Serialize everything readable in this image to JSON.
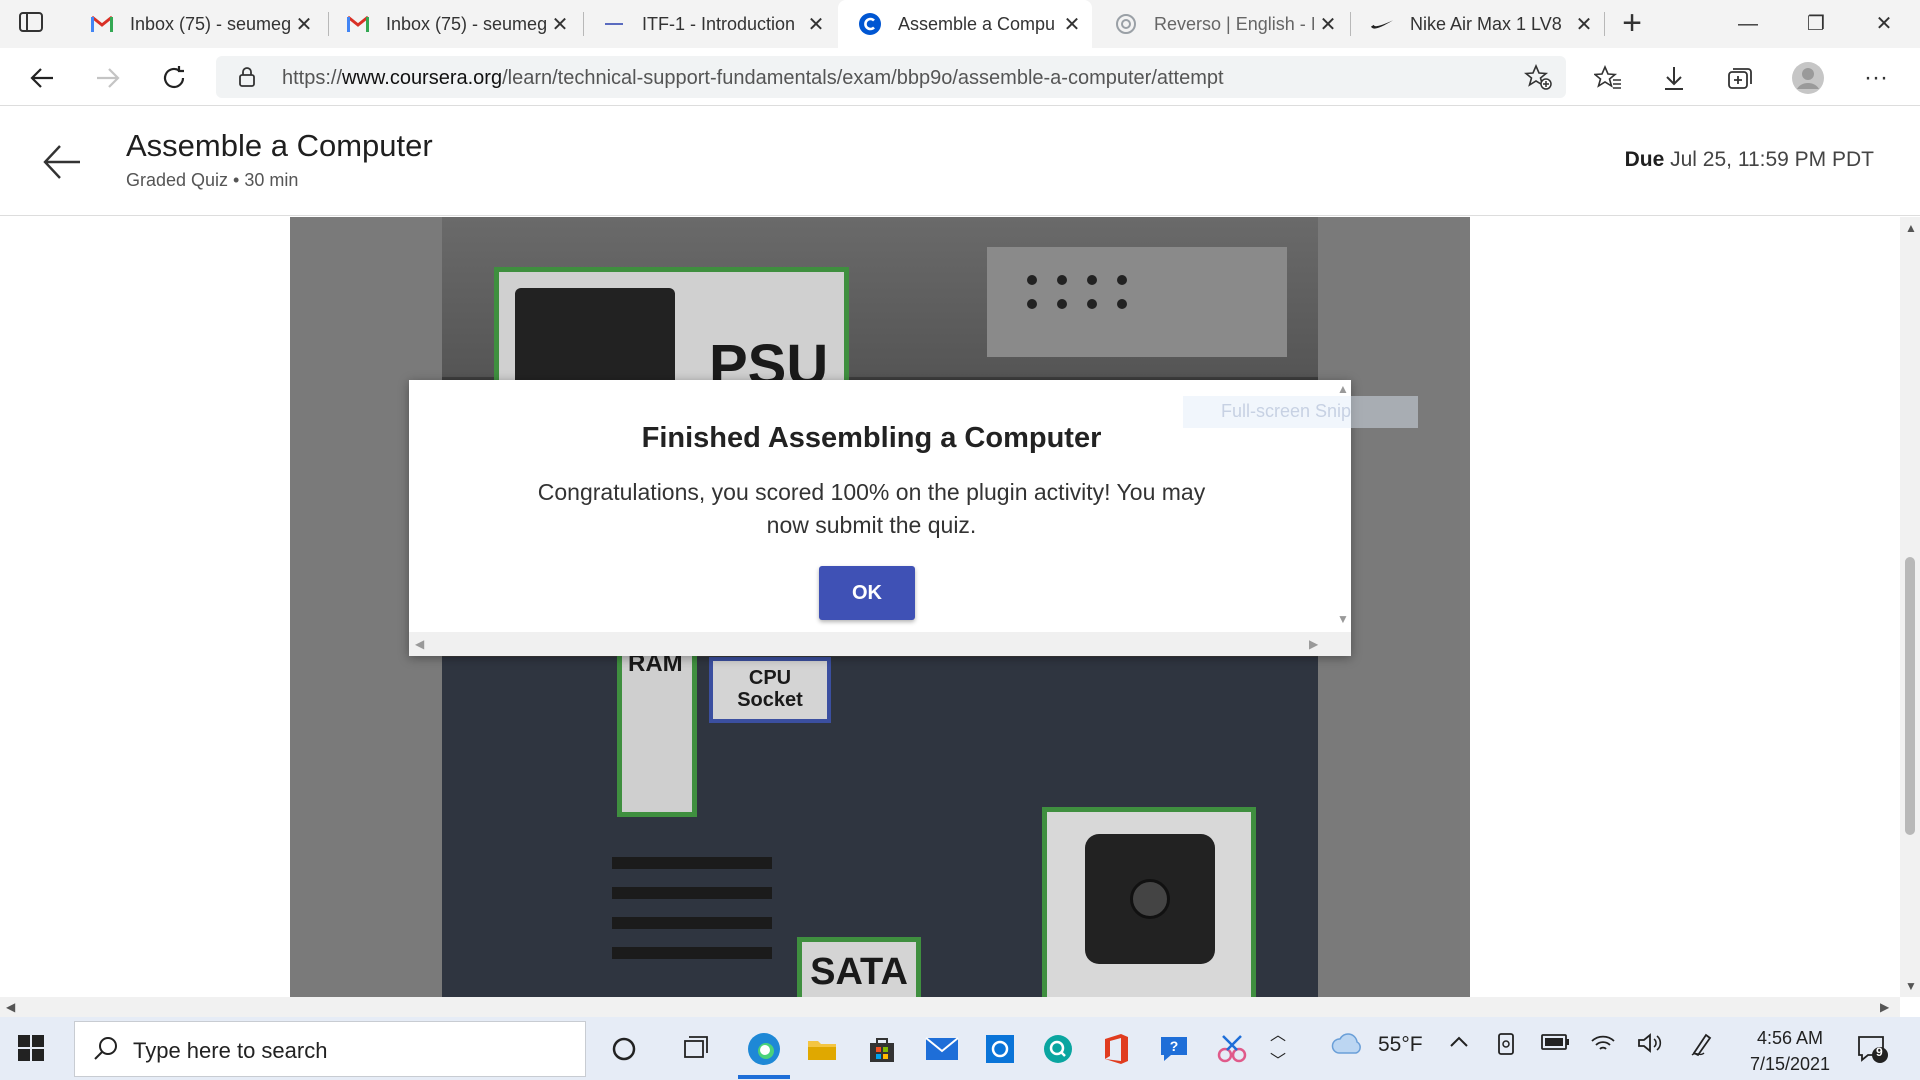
{
  "browser": {
    "tabs": [
      {
        "title": "Inbox (75) - seumeg",
        "icon": "gmail-icon",
        "active": false
      },
      {
        "title": "Inbox (75) - seumeg",
        "icon": "gmail-icon",
        "active": false
      },
      {
        "title": "ITF-1 - Introduction",
        "icon": "generic-tab-icon",
        "active": false
      },
      {
        "title": "Assemble a Compu",
        "icon": "coursera-icon",
        "active": true
      },
      {
        "title": "Reverso | English - I",
        "icon": "reverso-icon",
        "active": false
      },
      {
        "title": "Nike Air Max 1 LV8",
        "icon": "nike-icon",
        "active": false
      }
    ],
    "url_prefix": "https://",
    "url_host": "www.coursera.org",
    "url_path": "/learn/technical-support-fundamentals/exam/bbp9o/assemble-a-computer/attempt"
  },
  "course": {
    "title": "Assemble a Computer",
    "subtitle": "Graded Quiz • 30 min",
    "due_label": "Due",
    "due_value": "Jul 25, 11:59 PM PDT"
  },
  "activity": {
    "labels": {
      "psu": "PSU",
      "ram": "RAM",
      "cpu_line1": "CPU",
      "cpu_line2": "Socket",
      "sata": "SATA"
    }
  },
  "modal": {
    "title": "Finished Assembling a Computer",
    "message": "Congratulations, you scored 100% on the plugin activity! You may now submit the quiz.",
    "ok_label": "OK",
    "overlay_text": "Full-screen Snip"
  },
  "taskbar": {
    "search_placeholder": "Type here to search",
    "weather": "55°F",
    "time": "4:56 AM",
    "date": "7/15/2021",
    "notification_count": "9"
  },
  "colors": {
    "accent": "#3f51b5",
    "slot_green": "#3f8f3f",
    "slot_blue": "#3b4fa0"
  }
}
